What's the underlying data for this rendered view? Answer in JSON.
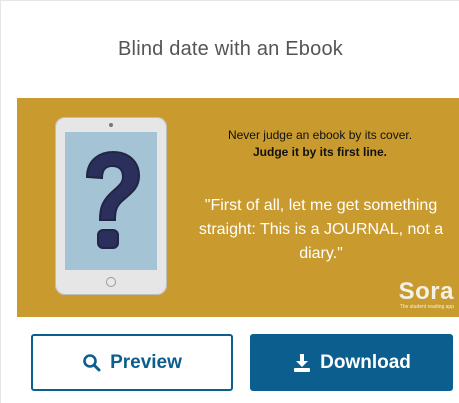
{
  "card": {
    "title": "Blind date with an Ebook"
  },
  "banner": {
    "background_color": "#c99a2e",
    "line1": "Never judge an ebook by its cover.",
    "line2": "Judge it by its first line.",
    "quote": "\"First of all, let me get something straight: This is a JOURNAL, not a diary.\"",
    "device_icon": "tablet-question-mark-icon",
    "logo": {
      "word": "Sora",
      "tagline": "The student reading app"
    }
  },
  "buttons": {
    "preview": {
      "label": "Preview",
      "icon": "search-icon"
    },
    "download": {
      "label": "Download",
      "icon": "download-icon"
    }
  },
  "colors": {
    "primary": "#0b5e8e",
    "title_text": "#555555"
  }
}
